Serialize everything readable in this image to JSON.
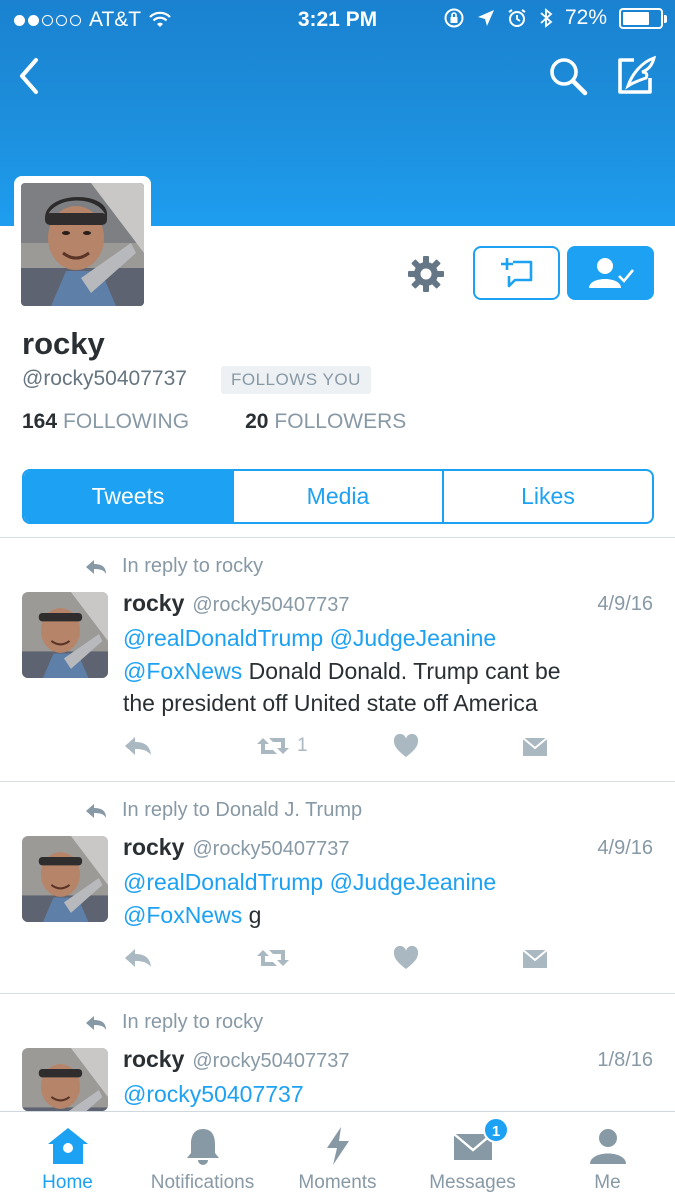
{
  "status_bar": {
    "carrier": "AT&T",
    "time": "3:21 PM",
    "battery": "72%",
    "battery_level": 0.72,
    "signal_dots_filled": 2,
    "signal_dots_total": 5
  },
  "nav": {
    "back_icon": "chevron-left-icon",
    "search_icon": "search-icon",
    "compose_icon": "compose-icon"
  },
  "profile": {
    "name": "rocky",
    "handle": "@rocky50407737",
    "follows_you": "FOLLOWS YOU",
    "following_count": "164",
    "following_label": "FOLLOWING",
    "followers_count": "20",
    "followers_label": "FOLLOWERS"
  },
  "tabs": [
    {
      "label": "Tweets",
      "active": true
    },
    {
      "label": "Media",
      "active": false
    },
    {
      "label": "Likes",
      "active": false
    }
  ],
  "tweets": [
    {
      "reply_to": "In reply to rocky",
      "name": "rocky",
      "handle": "@rocky50407737",
      "date": "4/9/16",
      "line1_mentions": "@realDonaldTrump @JudgeJeanine",
      "line2_mention": "@FoxNews",
      "line2_text": " Donald Donald. Trump cant be",
      "line3_text": "the president off United state off America",
      "retweet_count": "1"
    },
    {
      "reply_to": "In reply to Donald J. Trump",
      "name": "rocky",
      "handle": "@rocky50407737",
      "date": "4/9/16",
      "line1_mentions": "@realDonaldTrump @JudgeJeanine",
      "line2_mention": "@FoxNews",
      "line2_text": " g",
      "retweet_count": ""
    },
    {
      "reply_to": "In reply to rocky",
      "name": "rocky",
      "handle": "@rocky50407737",
      "date": "1/8/16",
      "line1_mentions": "@rocky50407737"
    }
  ],
  "bottom_bar": [
    {
      "label": "Home",
      "icon": "home-icon",
      "active": true
    },
    {
      "label": "Notifications",
      "icon": "bell-icon",
      "active": false
    },
    {
      "label": "Moments",
      "icon": "lightning-icon",
      "active": false
    },
    {
      "label": "Messages",
      "icon": "envelope-icon",
      "active": false,
      "badge": "1"
    },
    {
      "label": "Me",
      "icon": "person-icon",
      "active": false
    }
  ],
  "colors": {
    "brand": "#1da1f2",
    "banner": "#1d8fdc",
    "muted_text": "#8899a6"
  }
}
